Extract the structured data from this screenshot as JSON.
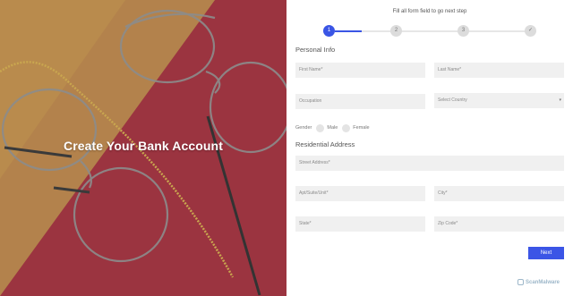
{
  "hero": {
    "title": "Create Your Bank Account"
  },
  "header": {
    "hint": "Fill all form field to go next step"
  },
  "stepper": {
    "steps": [
      {
        "label": "1",
        "state": "active"
      },
      {
        "label": "2",
        "state": "inactive"
      },
      {
        "label": "3",
        "state": "inactive"
      },
      {
        "label": "✓",
        "state": "inactive"
      }
    ]
  },
  "personal": {
    "title": "Personal Info",
    "first_name": "First Name*",
    "last_name": "Last Name*",
    "occupation": "Occupation",
    "country": "Select Country",
    "gender_label": "Gender",
    "male": "Male",
    "female": "Female"
  },
  "address": {
    "title": "Residential Address",
    "street": "Street Address*",
    "apt": "Apt/Suite/Unit*",
    "city": "City*",
    "state": "State*",
    "zip": "Zip Code*"
  },
  "actions": {
    "next": "Next"
  },
  "watermark": {
    "text": "ScanMalware"
  },
  "colors": {
    "accent": "#3a55e5",
    "field_bg": "#f0f0f0"
  }
}
